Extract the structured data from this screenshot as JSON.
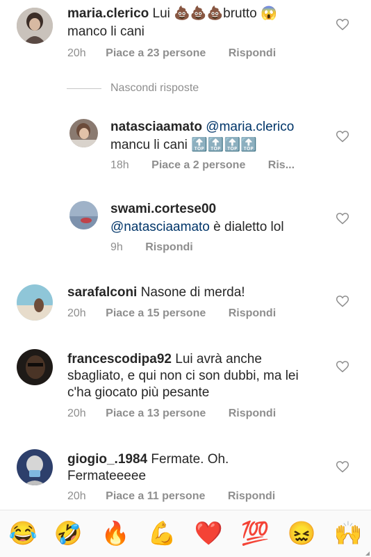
{
  "comments": [
    {
      "username": "maria.clerico",
      "text_line1": "Lui 💩💩💩brutto 😱",
      "text_line2": "manco li cani",
      "time": "20h",
      "likes": "Piace a 23 persone",
      "reply": "Rispondi"
    },
    {
      "username": "natasciaamato",
      "mention": "@maria.clerico",
      "text_line2": "mancu li cani 🔝🔝🔝🔝",
      "time": "18h",
      "likes": "Piace a 2 persone",
      "reply": "Ris..."
    },
    {
      "username": "swami.cortese00",
      "mention": "@natasciaamato",
      "text_rest": " è dialetto lol",
      "time": "9h",
      "reply": "Rispondi"
    },
    {
      "username": "sarafalconi",
      "text_line1": "Nasone di merda!",
      "time": "20h",
      "likes": "Piace a 15 persone",
      "reply": "Rispondi"
    },
    {
      "username": "francescodipa92",
      "text_line1": "Lui avrà anche",
      "text_line2": "sbagliato, e qui non ci son dubbi, ma lei",
      "text_line3": "c'ha giocato più pesante",
      "time": "20h",
      "likes": "Piace a 13 persone",
      "reply": "Rispondi"
    },
    {
      "username": "giogio_.1984",
      "text_line1": "Fermate. Oh.",
      "text_line2": "Fermateeeee",
      "time": "20h",
      "likes": "Piace a 11 persone",
      "reply": "Rispondi"
    }
  ],
  "hide_replies": "Nascondi risposte",
  "emoji_bar": [
    "😂",
    "🤣",
    "🔥",
    "💪",
    "❤️",
    "💯",
    "😖",
    "🙌"
  ],
  "colors": {
    "text": "#262626",
    "meta": "#8e8e8e",
    "mention": "#003569",
    "heart_outline": "#8e8e8e"
  }
}
